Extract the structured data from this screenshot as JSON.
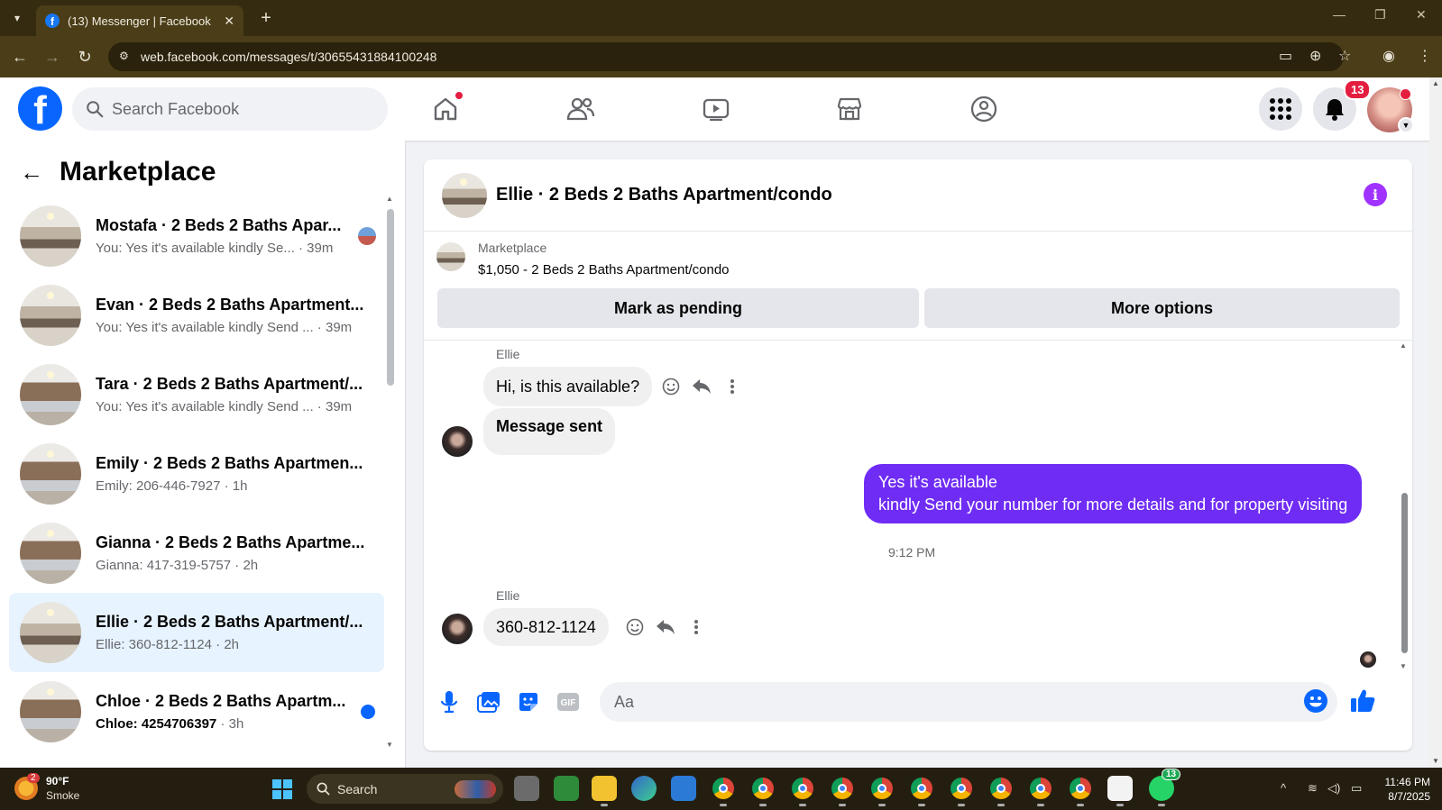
{
  "browser": {
    "tab_title": "(13) Messenger | Facebook",
    "url": "web.facebook.com/messages/t/30655431884100248"
  },
  "fb_header": {
    "search_placeholder": "Search Facebook",
    "notification_count": "13",
    "brand_color": "#0866ff"
  },
  "left_panel": {
    "title": "Marketplace",
    "conversations": [
      {
        "name": "Mostafa · 2 Beds 2 Baths Apar...",
        "preview": "You: Yes it's available kindly Se...",
        "time": "39m",
        "indicator": "seen-avatar"
      },
      {
        "name": "Evan · 2 Beds 2 Baths Apartment...",
        "preview": "You: Yes it's available kindly Send ...",
        "time": "39m"
      },
      {
        "name": "Tara · 2 Beds 2 Baths Apartment/...",
        "preview": "You: Yes it's available kindly Send ...",
        "time": "39m"
      },
      {
        "name": "Emily · 2 Beds 2 Baths Apartmen...",
        "preview": "Emily: 206-446-7927",
        "time": "1h"
      },
      {
        "name": "Gianna · 2 Beds 2 Baths Apartme...",
        "preview": "Gianna: 417-319-5757",
        "time": "2h"
      },
      {
        "name": "Ellie · 2 Beds 2 Baths Apartment/...",
        "preview": "Ellie: 360-812-1124",
        "time": "2h",
        "active": true
      },
      {
        "name": "Chloe · 2 Beds 2 Baths Apartm...",
        "preview": "Chloe: 4254706397",
        "time": "3h",
        "unread": true
      }
    ]
  },
  "chat": {
    "header_name": "Ellie · 2 Beds 2 Baths Apartment/condo",
    "listing_label": "Marketplace",
    "listing_price": "$1,050 - 2 Beds 2 Baths Apartment/condo",
    "mark_pending_label": "Mark as pending",
    "more_options_label": "More options",
    "messages": [
      {
        "sender": "Ellie",
        "text": "Hi, is this available?",
        "direction": "in"
      },
      {
        "text": "Message sent",
        "direction": "in"
      },
      {
        "text_line1": "Yes it's available",
        "text_line2": "kindly Send your number for more details and for property visiting",
        "direction": "out"
      },
      {
        "timestamp": "9:12 PM"
      },
      {
        "sender": "Ellie",
        "text": "360-812-1124",
        "direction": "in"
      }
    ],
    "composer_placeholder": "Aa",
    "outgoing_color": "#6f2cf4"
  },
  "taskbar": {
    "weather_temp": "90°F",
    "weather_desc": "Smoke",
    "weather_badge": "2",
    "search_label": "Search",
    "whatsapp_badge": "13",
    "time": "11:46 PM",
    "date": "8/7/2025"
  }
}
